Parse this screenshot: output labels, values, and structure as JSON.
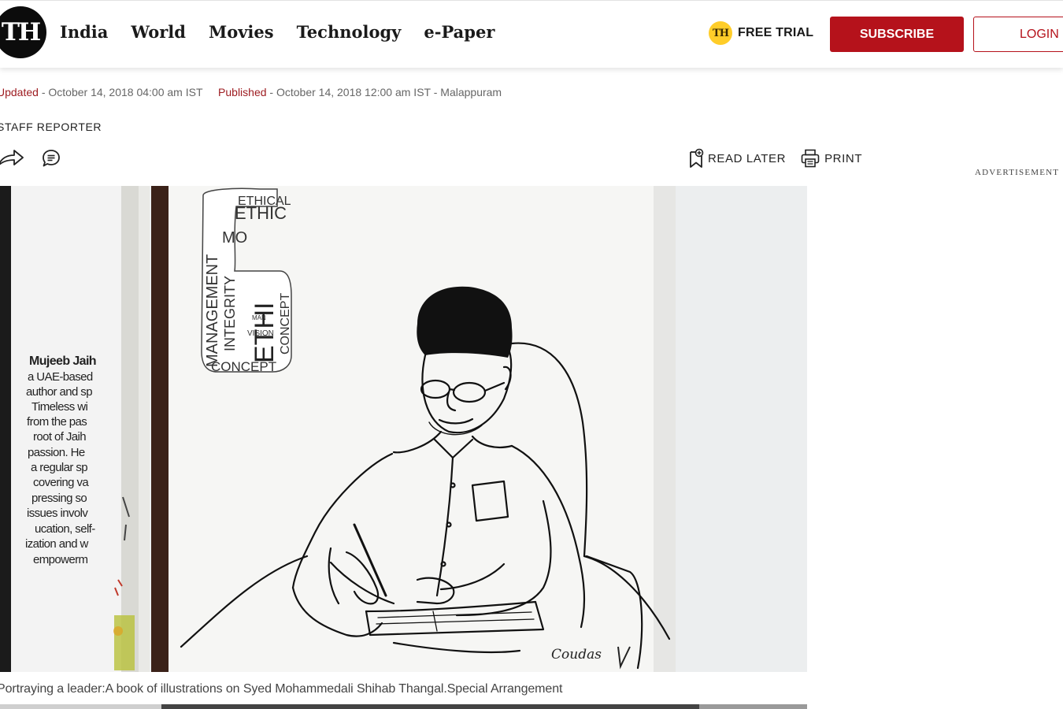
{
  "header": {
    "logo_text": "TH",
    "nav": [
      "India",
      "World",
      "Movies",
      "Technology",
      "e-Paper"
    ],
    "trial_badge": "TH",
    "trial_label": "FREE TRIAL",
    "subscribe_label": "SUBSCRIBE",
    "login_label": "LOGIN"
  },
  "article": {
    "updated_label": "Updated",
    "updated_text": "- October 14, 2018 04:00 am IST",
    "published_label": "Published",
    "published_text": "- October 14, 2018 12:00 am IST - Malappuram",
    "byline": "STAFF REPORTER",
    "read_later_label": "READ LATER",
    "print_label": "PRINT",
    "advertisement_label": "ADVERTISEMENT",
    "caption": "Portraying a leader:A book of illustrations on Syed Mohammedali Shihab Thangal.Special Arrangement"
  },
  "figure": {
    "book_text_lines": [
      "Mujeeb Jaih",
      "a UAE-based",
      "author and sp",
      "Timeless wi",
      "from the pas",
      "root of Jaih",
      "passion. He",
      "a regular sp",
      "covering va",
      "pressing so",
      "issues involv",
      "ucation, self-",
      "ization and w",
      "empowerm"
    ],
    "word_cloud": [
      "ETHICAL",
      "ETHIC",
      "MANAGEMENT",
      "INTEGRITY",
      "ETHI",
      "CONCEPT",
      "CONCEPT",
      "MO",
      "VISION",
      "MAN"
    ],
    "signature": "Coudas"
  },
  "colors": {
    "brand_red": "#b5121b",
    "trial_yellow": "#ffcd29",
    "label_red": "#9e1d22"
  }
}
